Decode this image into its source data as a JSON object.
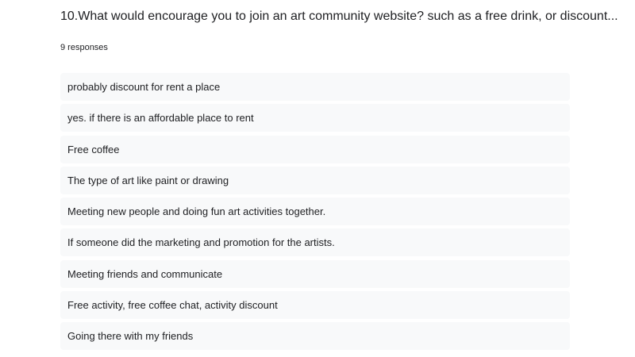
{
  "question": {
    "title": "10.What would encourage you to join an art community website? such as a free drink, or discount...",
    "response_count": "9 responses"
  },
  "responses": [
    "probably discount for rent a place",
    "yes. if there is an affordable place to rent",
    "Free coffee",
    "The type of art like paint or drawing",
    "Meeting new people and doing fun art activities together.",
    "If someone did the marketing and promotion for the artists.",
    "Meeting friends and communicate",
    "Free activity, free coffee chat, activity discount",
    "Going there with my friends"
  ],
  "colors": {
    "background": "#ffffff",
    "item_background": "#f8f9fa",
    "text": "#202124"
  }
}
